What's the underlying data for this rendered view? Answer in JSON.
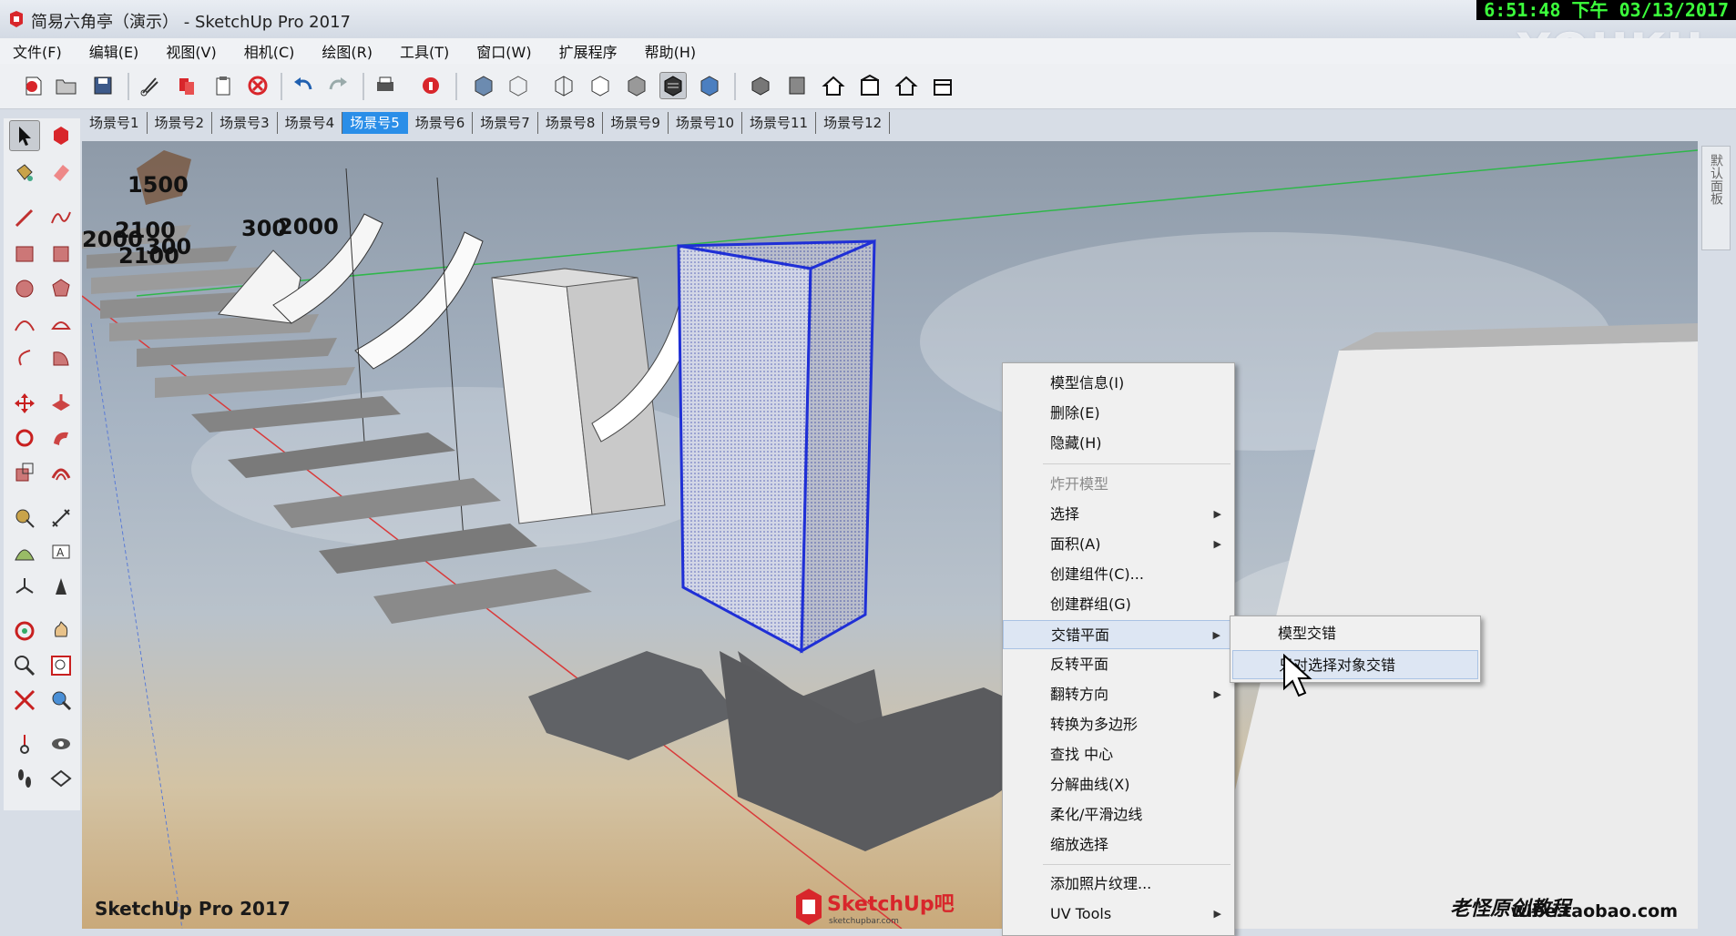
{
  "window": {
    "title": "简易六角亭（演示） - SketchUp Pro 2017",
    "clock": "6:51:48 下午 03/13/2017",
    "watermark": "YOUKU"
  },
  "menubar": {
    "items": [
      "文件(F)",
      "编辑(E)",
      "视图(V)",
      "相机(C)",
      "绘图(R)",
      "工具(T)",
      "窗口(W)",
      "扩展程序",
      "帮助(H)"
    ]
  },
  "scenes": {
    "tabs": [
      "场景号1",
      "场景号2",
      "场景号3",
      "场景号4",
      "场景号5",
      "场景号6",
      "场景号7",
      "场景号8",
      "场景号9",
      "场景号10",
      "场景号11",
      "场景号12"
    ],
    "active_index": 4
  },
  "right_panel": {
    "label": "默认面板"
  },
  "viewport": {
    "dimension_labels": [
      "1500",
      "2000",
      "2100",
      "300",
      "2000",
      "300",
      "2100"
    ],
    "brand_text": "SketchUp Pro 2017",
    "logo_text": "SketchUp吧",
    "logo_subtext": "sketchupbar.com",
    "signature": "老怪原创教程",
    "url": "wibe.taobao.com"
  },
  "context_menu": {
    "items": [
      {
        "label": "模型信息(I)",
        "submenu": false,
        "disabled": false
      },
      {
        "label": "删除(E)",
        "submenu": false,
        "disabled": false
      },
      {
        "label": "隐藏(H)",
        "submenu": false,
        "disabled": false
      },
      {
        "label": "炸开模型",
        "submenu": false,
        "disabled": true
      },
      {
        "label": "选择",
        "submenu": true,
        "disabled": false
      },
      {
        "label": "面积(A)",
        "submenu": true,
        "disabled": false
      },
      {
        "label": "创建组件(C)...",
        "submenu": false,
        "disabled": false
      },
      {
        "label": "创建群组(G)",
        "submenu": false,
        "disabled": false
      },
      {
        "label": "交错平面",
        "submenu": true,
        "disabled": false
      },
      {
        "label": "反转平面",
        "submenu": false,
        "disabled": false
      },
      {
        "label": "翻转方向",
        "submenu": true,
        "disabled": false
      },
      {
        "label": "转换为多边形",
        "submenu": false,
        "disabled": false
      },
      {
        "label": "查找 中心",
        "submenu": false,
        "disabled": false
      },
      {
        "label": "分解曲线(X)",
        "submenu": false,
        "disabled": false
      },
      {
        "label": "柔化/平滑边线",
        "submenu": false,
        "disabled": false
      },
      {
        "label": "缩放选择",
        "submenu": false,
        "disabled": false
      },
      {
        "label": "添加照片纹理...",
        "submenu": false,
        "disabled": false
      },
      {
        "label": "UV Tools",
        "submenu": true,
        "disabled": false
      }
    ],
    "highlighted_index": 8
  },
  "sub_menu": {
    "items": [
      "模型交错",
      "只对选择对象交错"
    ],
    "highlighted_index": 1
  },
  "colors": {
    "accent": "#2a8ee8",
    "selection_blue": "#1f2fd6",
    "axis_red": "#d93a3a",
    "axis_green": "#2fb74a"
  }
}
